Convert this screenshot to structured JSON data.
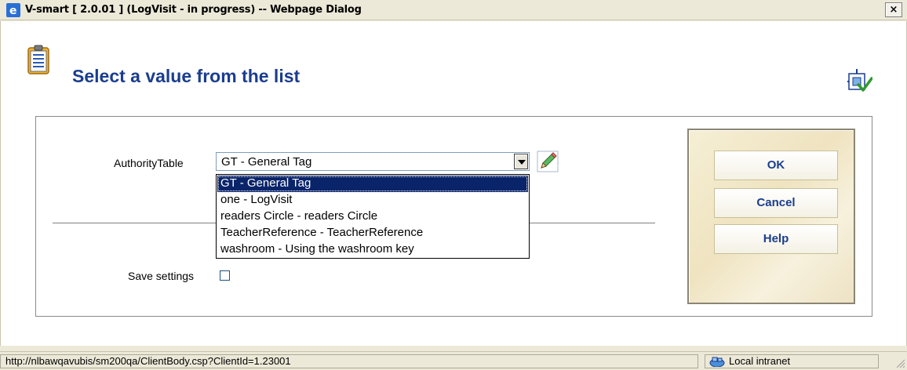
{
  "window": {
    "title": "V-smart [ 2.0.01 ] (LogVisit - in progress) -- Webpage Dialog",
    "close_glyph": "×"
  },
  "header": {
    "title": "Select a value from the list",
    "icon": "clipboard-list-icon",
    "corner_icon": "checklist-settings-icon"
  },
  "form": {
    "field_label": "AuthorityTable",
    "selected_value": "GT - General Tag",
    "dropdown_options": [
      "GT - General Tag",
      "one - LogVisit",
      "readers Circle - readers Circle",
      "TeacherReference - TeacherReference",
      "washroom - Using the washroom key"
    ],
    "save_label": "Save settings",
    "save_checked": false
  },
  "buttons": {
    "ok": "OK",
    "cancel": "Cancel",
    "help": "Help"
  },
  "statusbar": {
    "url": "http://nlbawqavubis/sm200qa/ClientBody.csp?ClientId=1.23001",
    "zone": "Local intranet"
  },
  "colors": {
    "title_text": "#1a3d8f",
    "selection_bg": "#0a246a",
    "button_text": "#1a3d8f"
  }
}
